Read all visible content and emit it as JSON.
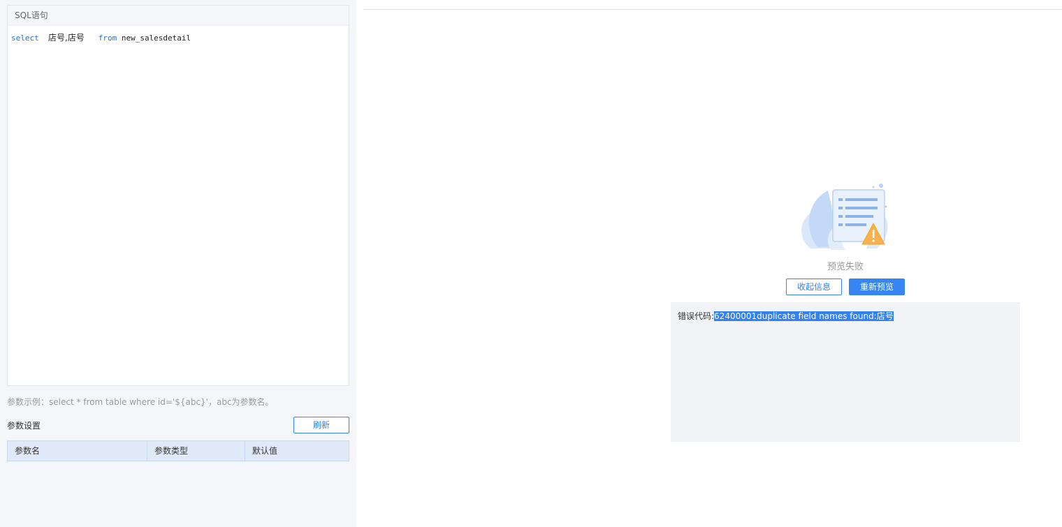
{
  "sql_panel": {
    "title": "SQL语句",
    "query": {
      "kw_select": "select",
      "fields": "店号,店号",
      "kw_from": "from",
      "table": "new_salesdetail"
    }
  },
  "params": {
    "hint": "参数示例：select * from table where id='${abc}'，abc为参数名。",
    "title": "参数设置",
    "refresh_label": "刷新",
    "columns": [
      "参数名",
      "参数类型",
      "默认值"
    ]
  },
  "preview": {
    "status_text": "预览失败",
    "collapse_label": "收起信息",
    "repreview_label": "重新预览",
    "error_prefix": "错误代码:",
    "error_message": "62400001duplicate field names found:店号"
  },
  "colors": {
    "accent": "#3685f2",
    "warning": "#f5a623"
  }
}
